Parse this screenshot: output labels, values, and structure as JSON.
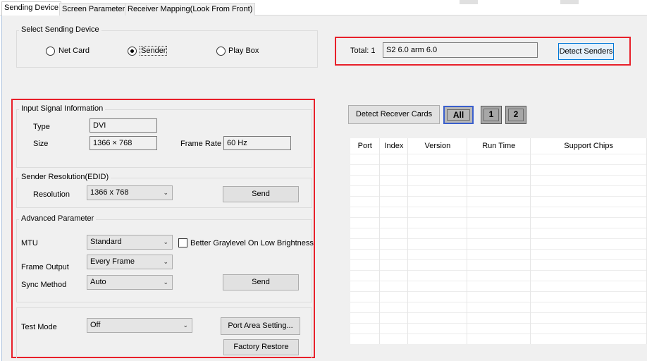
{
  "tabs": [
    {
      "label": "Sending Device"
    },
    {
      "label": "Screen Parameters"
    },
    {
      "label": "Receiver Mapping(Look From Front)"
    }
  ],
  "select_device": {
    "legend": "Select Sending Device",
    "options": [
      {
        "label": "Net Card",
        "selected": false
      },
      {
        "label": "Sender",
        "selected": true
      },
      {
        "label": "Play Box",
        "selected": false
      }
    ]
  },
  "senders": {
    "total_label": "Total: 1",
    "value": "S2 6.0 arm 6.0",
    "detect_button": "Detect Senders"
  },
  "input_signal": {
    "legend": "Input Signal Information",
    "type_label": "Type",
    "type_value": "DVI",
    "size_label": "Size",
    "size_value": "1366 × 768",
    "frame_rate_label": "Frame Rate",
    "frame_rate_value": "60 Hz"
  },
  "sender_resolution": {
    "legend": "Sender Resolution(EDID)",
    "resolution_label": "Resolution",
    "resolution_value": "1366 x 768",
    "send_button": "Send"
  },
  "advanced": {
    "legend": "Advanced Parameter",
    "mtu_label": "MTU",
    "mtu_value": "Standard",
    "graylevel_label": "Better Graylevel On Low Brightness",
    "frame_output_label": "Frame Output",
    "frame_output_value": "Every Frame",
    "sync_label": "Sync Method",
    "sync_value": "Auto",
    "send_button": "Send"
  },
  "test": {
    "test_mode_label": "Test Mode",
    "test_mode_value": "Off",
    "port_area_button": "Port Area Setting...",
    "factory_button": "Factory Restore"
  },
  "receiver": {
    "detect_button": "Detect Recever Cards",
    "all_button": "All",
    "port_buttons": [
      "1",
      "2"
    ],
    "columns": [
      "Port",
      "Index",
      "Version",
      "Run Time",
      "Support Chips"
    ]
  },
  "colors": {
    "highlight": "#e8202a",
    "selection": "#3a5fcd"
  }
}
